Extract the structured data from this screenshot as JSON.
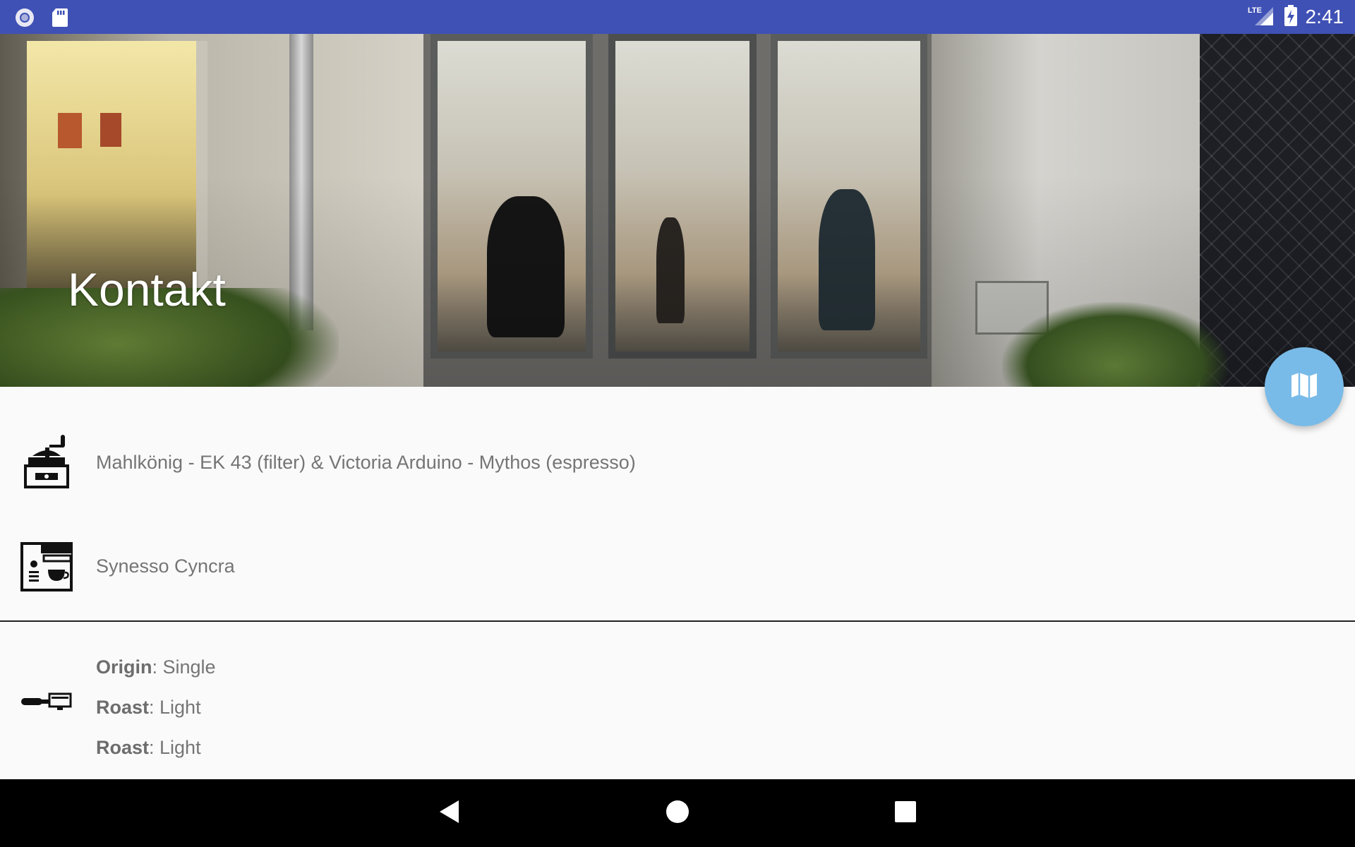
{
  "status_bar": {
    "time": "2:41",
    "network": "LTE",
    "background_color": "#3f51b5"
  },
  "header": {
    "title": "Kontakt"
  },
  "fab": {
    "icon": "map-icon",
    "color": "#79bbe8"
  },
  "grinder": {
    "icon": "coffee-grinder-icon",
    "text": "Mahlkönig - EK 43 (filter) & Victoria Arduino - Mythos (espresso)"
  },
  "machine": {
    "icon": "espresso-machine-icon",
    "text": "Synesso Cyncra"
  },
  "beans": {
    "icon": "portafilter-icon",
    "properties": [
      {
        "label": "Origin",
        "value": ": Single"
      },
      {
        "label": "Roast",
        "value": ": Light"
      },
      {
        "label": "Roast",
        "value": ": Light"
      }
    ]
  },
  "nav_bar": {
    "back": "back-icon",
    "home": "home-icon",
    "recents": "recents-icon"
  }
}
